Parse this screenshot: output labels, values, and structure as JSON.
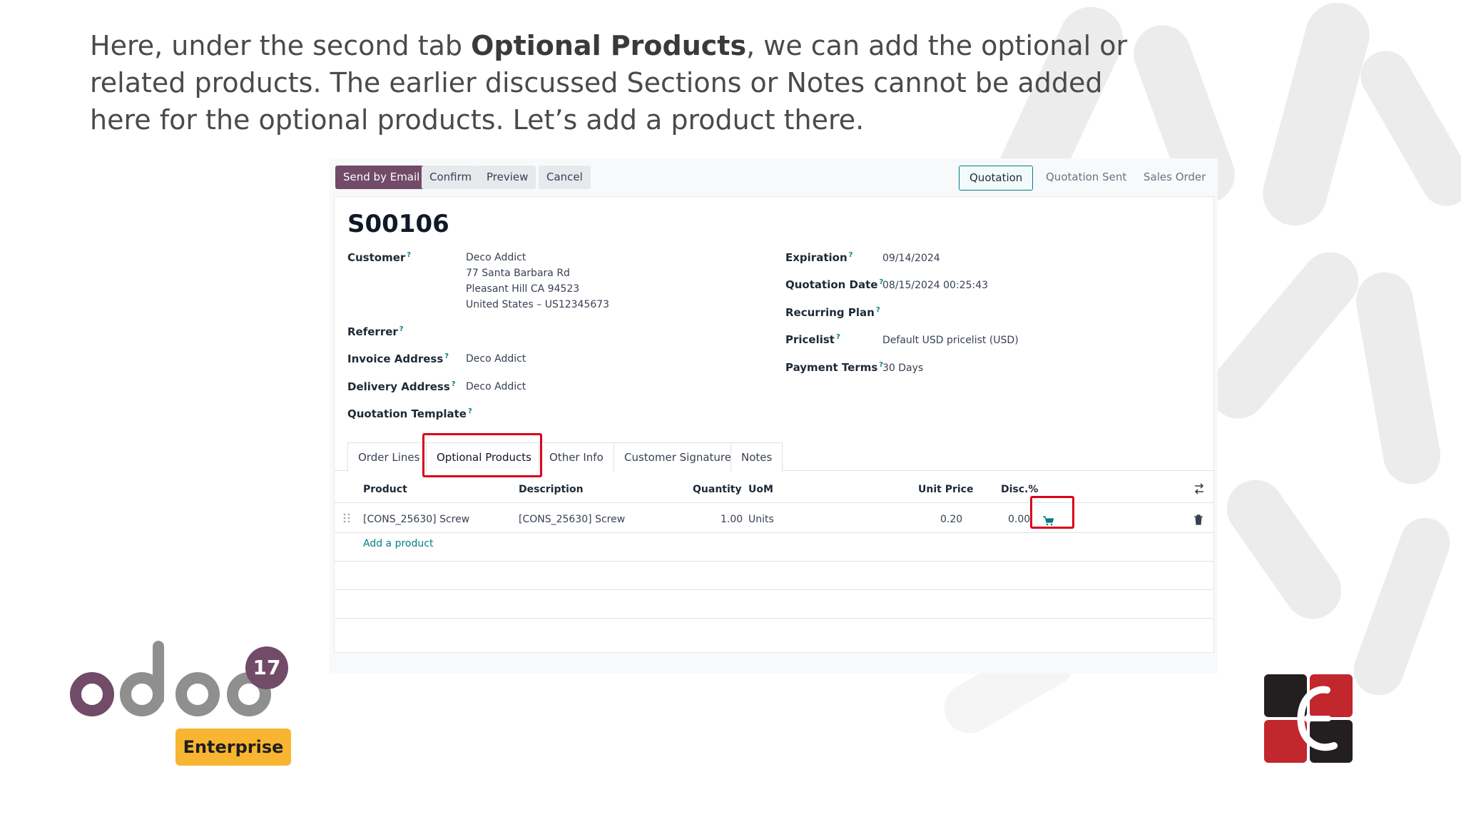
{
  "caption": {
    "part1": "Here, under the second tab ",
    "bold": "Optional Products",
    "part2": ", we can add the optional or related products. The earlier discussed Sections or Notes cannot be added here for the optional products. Let’s add a product there."
  },
  "toolbar": {
    "send_email": "Send by Email",
    "confirm": "Confirm",
    "preview": "Preview",
    "cancel": "Cancel"
  },
  "statusbar": {
    "quotation": "Quotation",
    "quotation_sent": "Quotation Sent",
    "sales_order": "Sales Order"
  },
  "record": {
    "title": "S00106",
    "customer_label": "Customer",
    "customer_name": "Deco Addict",
    "customer_addr1": "77 Santa Barbara Rd",
    "customer_addr2": "Pleasant Hill CA 94523",
    "customer_addr3": "United States – US12345673",
    "referrer_label": "Referrer",
    "invoice_label": "Invoice Address",
    "invoice_value": "Deco Addict",
    "delivery_label": "Delivery Address",
    "delivery_value": "Deco Addict",
    "template_label": "Quotation Template",
    "expiration_label": "Expiration",
    "expiration_value": "09/14/2024",
    "qdate_label": "Quotation Date",
    "qdate_value": "08/15/2024 00:25:43",
    "recurring_label": "Recurring Plan",
    "pricelist_label": "Pricelist",
    "pricelist_value": "Default USD pricelist (USD)",
    "terms_label": "Payment Terms",
    "terms_value": "30 Days",
    "help_mark": "?"
  },
  "tabs": {
    "order_lines": "Order Lines",
    "optional_products": "Optional Products",
    "other_info": "Other Info",
    "customer_signature": "Customer Signature",
    "notes": "Notes"
  },
  "table": {
    "headers": {
      "product": "Product",
      "description": "Description",
      "quantity": "Quantity",
      "uom": "UoM",
      "unit_price": "Unit Price",
      "disc": "Disc.%"
    },
    "row": {
      "product": "[CONS_25630] Screw",
      "description": "[CONS_25630] Screw",
      "quantity": "1.00",
      "uom": "Units",
      "unit_price": "0.20",
      "disc": "0.00"
    },
    "add_product": "Add a product"
  },
  "branding": {
    "version": "17",
    "edition": "Enterprise"
  },
  "colors": {
    "primary": "#714b67",
    "accent": "#017e84",
    "highlight": "#d9001b",
    "enterprise": "#f8b531"
  }
}
